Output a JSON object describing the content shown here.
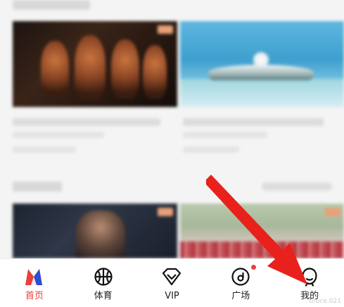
{
  "tabs": [
    {
      "label": "首页",
      "icon": "app-logo-icon",
      "active": true
    },
    {
      "label": "体育",
      "icon": "basketball-icon",
      "active": false
    },
    {
      "label": "VIP",
      "icon": "vip-diamond-icon",
      "active": false
    },
    {
      "label": "广场",
      "icon": "plaza-icon",
      "active": false,
      "has_dot": true
    },
    {
      "label": "我的",
      "icon": "profile-icon",
      "active": false
    }
  ],
  "watermark": "bruce.021",
  "colors": {
    "accent": "#e8403b",
    "tab_text": "#222222",
    "arrow": "#e8211c"
  }
}
